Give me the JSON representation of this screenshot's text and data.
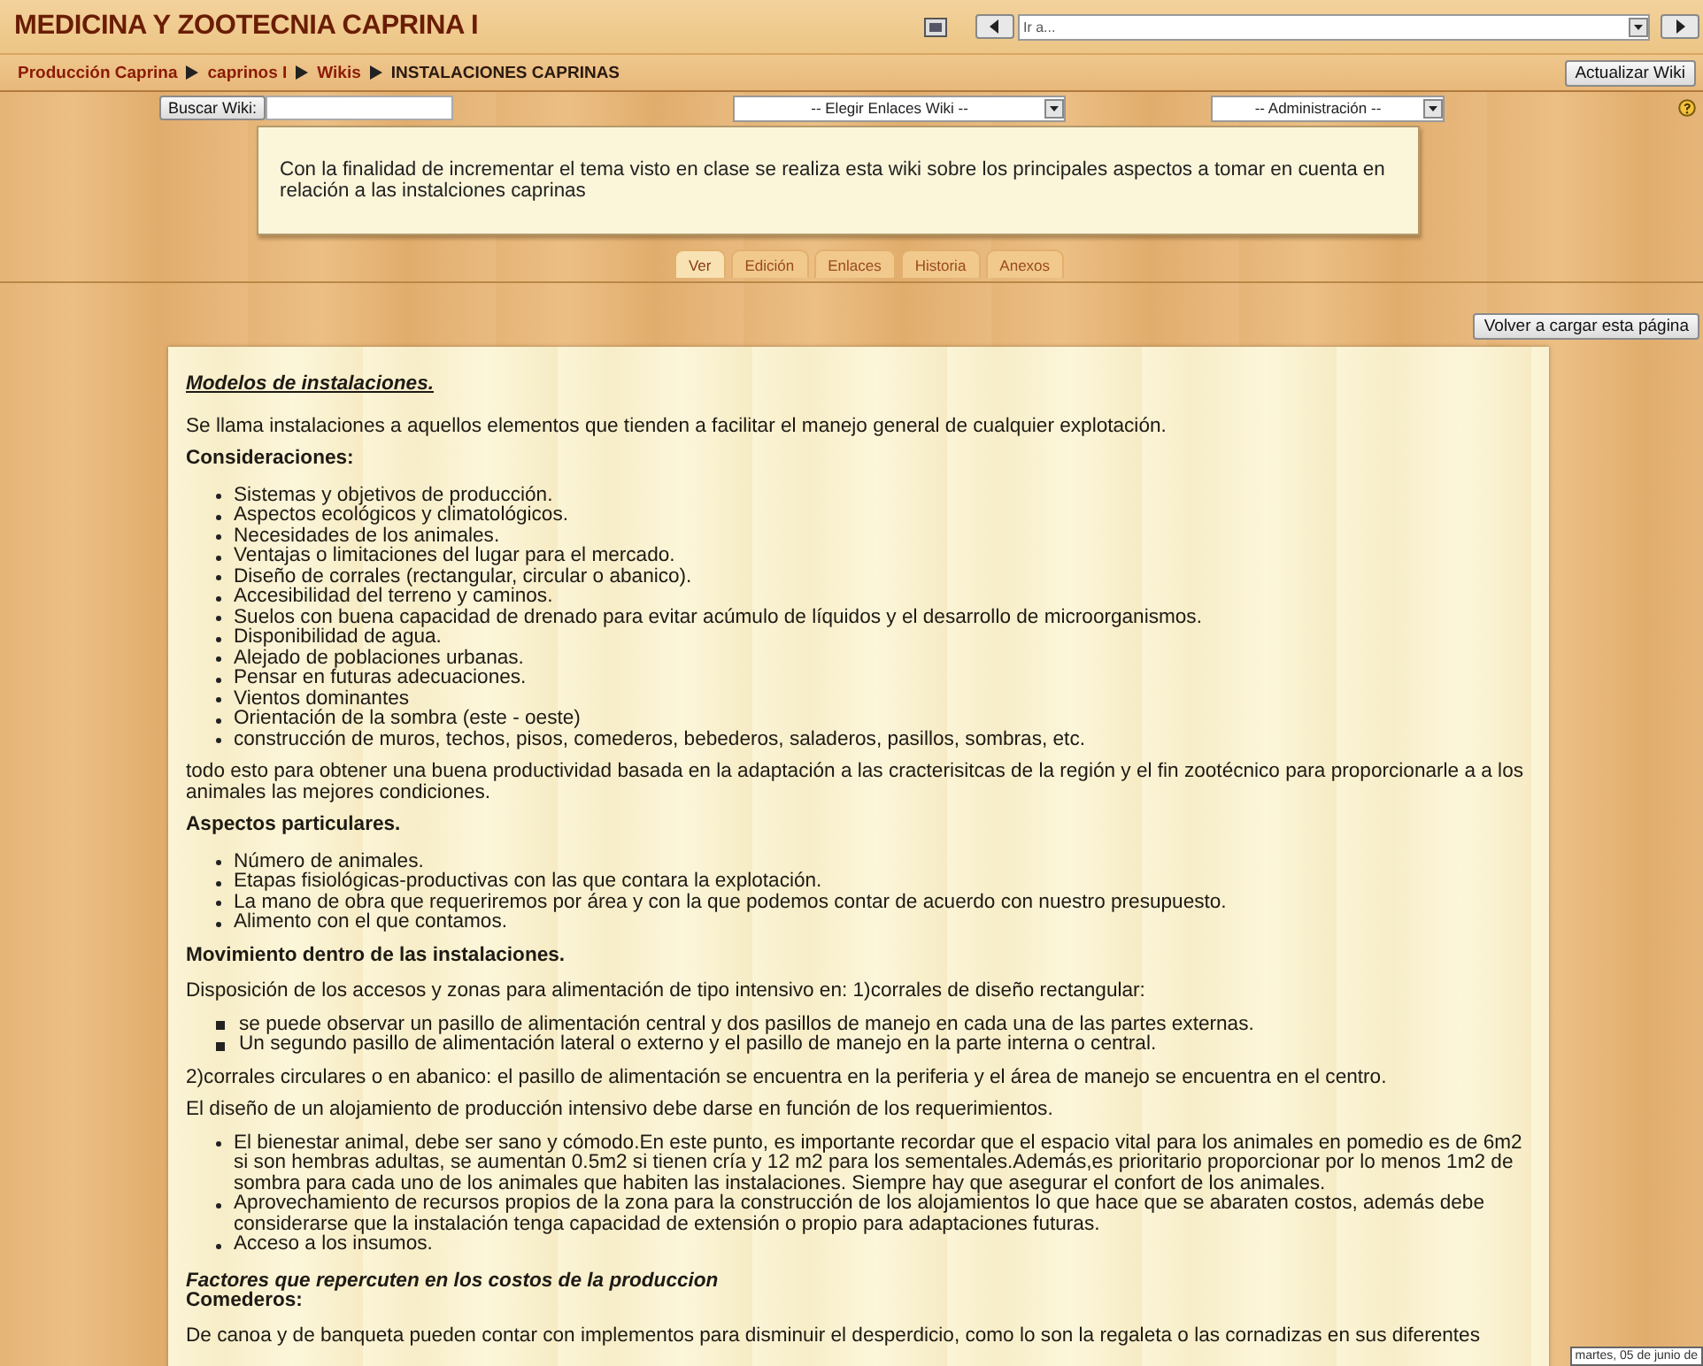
{
  "course_title": "MEDICINA Y ZOOTECNIA CAPRINA I",
  "jump_menu": {
    "placeholder": "Ir a..."
  },
  "breadcrumb": [
    "Producción Caprina",
    "caprinos I",
    "Wikis",
    "INSTALACIONES CAPRINAS"
  ],
  "update_button": "Actualizar Wiki",
  "search": {
    "button": "Buscar Wiki:"
  },
  "links_select": "-- Elegir Enlaces Wiki --",
  "admin_select": "-- Administración --",
  "summary": "Con la finalidad de incrementar el tema visto en clase se realiza esta wiki sobre los principales aspectos a tomar en cuenta en relación a las instalciones caprinas",
  "tabs": [
    {
      "label": "Ver",
      "selected": true
    },
    {
      "label": "Edición",
      "selected": false
    },
    {
      "label": "Enlaces",
      "selected": false
    },
    {
      "label": "Historia",
      "selected": false
    },
    {
      "label": "Anexos",
      "selected": false
    }
  ],
  "reload_button": "Volver a cargar esta página",
  "content": [
    {
      "kind": "title",
      "text": "Modelos de instalaciones."
    },
    {
      "kind": "paragraph",
      "text": "Se llama instalaciones a aquellos elementos que tienden a facilitar el manejo general de cualquier explotación."
    },
    {
      "kind": "heading",
      "text": "Consideraciones:"
    },
    {
      "kind": "bullets",
      "items": [
        "Sistemas y objetivos de producción.",
        "Aspectos ecológicos y climatológicos.",
        "Necesidades de los animales.",
        "Ventajas o limitaciones del lugar para el mercado.",
        "Diseño de corrales (rectangular, circular o abanico).",
        "Accesibilidad del terreno y caminos.",
        "Suelos con buena capacidad de drenado para evitar acúmulo de líquidos y el desarrollo de microorganismos.",
        "Disponibilidad de agua.",
        "Alejado de poblaciones urbanas.",
        "Pensar en futuras adecuaciones.",
        "Vientos dominantes",
        "Orientación de la sombra (este - oeste)",
        "construcción de muros, techos, pisos, comederos, bebederos, saladeros, pasillos, sombras, etc."
      ]
    },
    {
      "kind": "paragraph",
      "text": "todo esto para obtener una buena productividad basada en la adaptación a las cracterisitcas de la región y el fin zootécnico para proporcionarle a a los animales las mejores condiciones."
    },
    {
      "kind": "heading",
      "text": "Aspectos particulares."
    },
    {
      "kind": "bullets",
      "items": [
        "Número de animales.",
        "Etapas fisiológicas-productivas con las que contara la explotación.",
        "La mano de obra que requeriremos por área y con la que podemos contar de acuerdo con nuestro presupuesto.",
        "Alimento con el que contamos."
      ]
    },
    {
      "kind": "heading",
      "text": "Movimiento dentro de las instalaciones."
    },
    {
      "kind": "paragraph",
      "text": "Disposición de los accesos y zonas para alimentación de tipo intensivo en: 1)corrales de diseño rectangular:"
    },
    {
      "kind": "squares",
      "items": [
        "se puede observar un pasillo de alimentación central y dos pasillos de manejo en cada una de las partes externas.",
        "Un segundo pasillo de alimentación lateral o externo y el pasillo de manejo en la parte interna o central."
      ]
    },
    {
      "kind": "paragraph",
      "text": "2)corrales circulares o en abanico: el pasillo de alimentación se encuentra en la periferia y el área de manejo se encuentra en el centro."
    },
    {
      "kind": "paragraph",
      "text": "El diseño de un alojamiento de producción intensivo debe darse en función de los requerimientos."
    },
    {
      "kind": "bullets",
      "items": [
        "El bienestar animal, debe ser sano y cómodo.En este punto, es importante recordar que el espacio vital para los animales en pomedio es de 6m2 si son hembras adultas, se aumentan 0.5m2 si tienen cría y 12 m2 para los sementales.Además,es prioritario proporcionar por lo menos 1m2 de sombra para cada uno de los animales que habiten las instalaciones. Siempre hay que asegurar el confort de los animales.",
        "Aprovechamiento de recursos propios de la zona para la construcción de los alojamientos lo que hace que se abaraten costos, además debe considerarse que la instalación tenga capacidad de extensión o propio para adaptaciones futuras.",
        "Acceso a los insumos."
      ]
    },
    {
      "kind": "subtitle",
      "text": "Factores que repercuten en los costos de la produccion"
    },
    {
      "kind": "heading_tight",
      "text": "Comederos:"
    },
    {
      "kind": "paragraph",
      "text": "De canoa y de banqueta pueden contar con implementos para disminuir el desperdicio, como lo son la regaleta o las cornadizas en sus diferentes"
    }
  ],
  "date_tooltip": "martes, 05 de junio de"
}
